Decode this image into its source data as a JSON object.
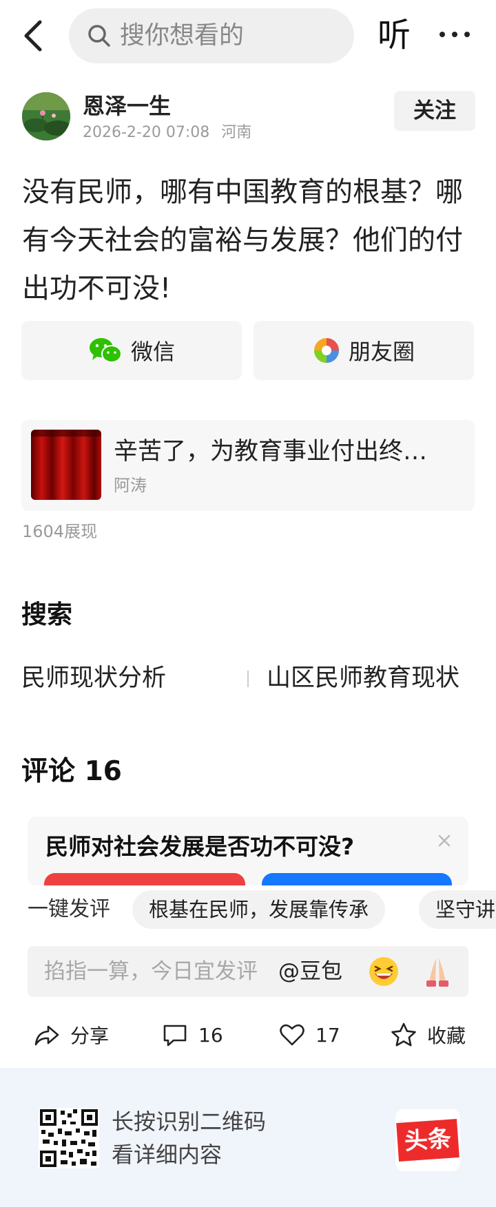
{
  "header": {
    "search_placeholder": "搜你想看的",
    "listen_label": "听"
  },
  "author": {
    "name": "恩泽一生",
    "timestamp": "2026-2-20 07:08",
    "location": "河南",
    "follow_label": "关注"
  },
  "post": {
    "text": "没有民师，哪有中国教育的根基？哪有今天社会的富裕与发展？他们的付出功不可没!"
  },
  "share": {
    "wechat_label": "微信",
    "moments_label": "朋友圈"
  },
  "related": {
    "title": "辛苦了，为教育事业付出终…",
    "author": "阿涛",
    "views": "1604展现"
  },
  "search_section": {
    "heading": "搜索",
    "terms": [
      "民师现状分析",
      "山区民师教育现状"
    ]
  },
  "comments": {
    "heading": "评论 16",
    "poll_question": "民师对社会发展是否功不可没?",
    "quick_label": "一键发评",
    "chips": [
      "根基在民师，发展靠传承",
      "坚守讲"
    ],
    "input_placeholder": "掐指一算，今日宜发评",
    "mention": "@豆包"
  },
  "actions": {
    "share_label": "分享",
    "comment_count": "16",
    "like_count": "17",
    "fav_label": "收藏"
  },
  "footer": {
    "line1": "长按识别二维码",
    "line2": "看详细内容",
    "brand": "头条"
  },
  "colors": {
    "poll_red": "#f04141",
    "poll_blue": "#1677ff",
    "wechat_green": "#2dc100",
    "brand_red": "#ee2b2b"
  }
}
